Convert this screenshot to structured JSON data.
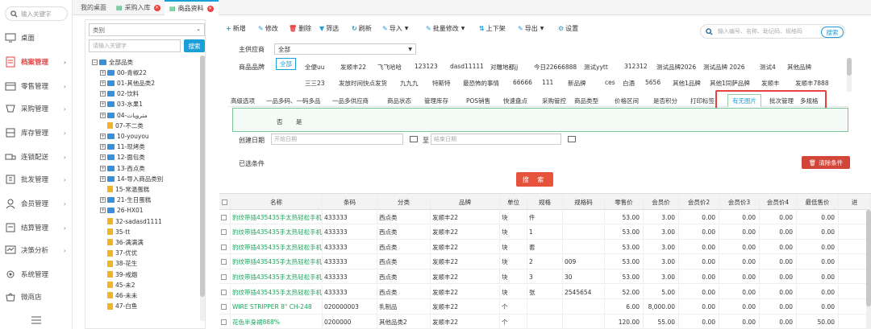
{
  "nav": {
    "search_placeholder": "输入关键字",
    "items": [
      {
        "label": "桌面",
        "icon": "desktop-icon"
      },
      {
        "label": "档案管理",
        "icon": "archive-icon",
        "active": true
      },
      {
        "label": "零售管理",
        "icon": "retail-icon"
      },
      {
        "label": "采购管理",
        "icon": "purchase-icon"
      },
      {
        "label": "库存管理",
        "icon": "inventory-icon"
      },
      {
        "label": "连锁配送",
        "icon": "delivery-icon"
      },
      {
        "label": "批发管理",
        "icon": "wholesale-icon"
      },
      {
        "label": "会员管理",
        "icon": "member-icon"
      },
      {
        "label": "结算管理",
        "icon": "settlement-icon"
      },
      {
        "label": "决策分析",
        "icon": "analysis-icon"
      },
      {
        "label": "系统管理",
        "icon": "gear-icon"
      },
      {
        "label": "微商店",
        "icon": "shop-icon"
      }
    ]
  },
  "tabs": [
    {
      "label": "我的桌面"
    },
    {
      "label": "采购入库"
    },
    {
      "label": "商品资料"
    }
  ],
  "tree": {
    "select_value": "类别",
    "search_placeholder": "请输入关键字",
    "search_button": "搜索",
    "nodes": [
      {
        "label": "全部品类",
        "level": 0,
        "type": "folder"
      },
      {
        "label": "00-青椒22",
        "level": 1,
        "type": "folder"
      },
      {
        "label": "01-其他品类2",
        "level": 1,
        "type": "folder"
      },
      {
        "label": "02-饮料",
        "level": 1,
        "type": "folder"
      },
      {
        "label": "03-水果1",
        "level": 1,
        "type": "folder"
      },
      {
        "label": "04-مترويات",
        "level": 1,
        "type": "folder"
      },
      {
        "label": "07-不二类",
        "level": 1,
        "type": "leaf"
      },
      {
        "label": "10-youyou",
        "level": 1,
        "type": "folder"
      },
      {
        "label": "11-现烤类",
        "level": 1,
        "type": "folder"
      },
      {
        "label": "12-面包类",
        "level": 1,
        "type": "folder"
      },
      {
        "label": "13-西点类",
        "level": 1,
        "type": "folder"
      },
      {
        "label": "14-导入商品类别",
        "level": 1,
        "type": "folder"
      },
      {
        "label": "15-常温蛋糕",
        "level": 1,
        "type": "leaf"
      },
      {
        "label": "21-生日蛋糕",
        "level": 1,
        "type": "folder"
      },
      {
        "label": "26-HX01",
        "level": 1,
        "type": "folder"
      },
      {
        "label": "32-sadasd1111",
        "level": 1,
        "type": "leaf"
      },
      {
        "label": "35-tt",
        "level": 1,
        "type": "leaf"
      },
      {
        "label": "36-满满满",
        "level": 1,
        "type": "leaf"
      },
      {
        "label": "37-优优",
        "level": 1,
        "type": "leaf"
      },
      {
        "label": "38-花生",
        "level": 1,
        "type": "leaf"
      },
      {
        "label": "39-戒烟",
        "level": 1,
        "type": "leaf"
      },
      {
        "label": "45-未2",
        "level": 1,
        "type": "leaf"
      },
      {
        "label": "46-未未",
        "level": 1,
        "type": "leaf"
      },
      {
        "label": "47-白鱼",
        "level": 1,
        "type": "leaf"
      }
    ]
  },
  "toolbar": {
    "new": "新增",
    "edit": "修改",
    "delete": "删除",
    "filter": "筛选",
    "refresh": "刷新",
    "import": "导入",
    "batch_edit": "批量修改",
    "onoff": "上下架",
    "export": "导出",
    "settings": "设置",
    "search_placeholder": "输入编号、名称、助记码、规格码",
    "search_button": "搜索"
  },
  "filters": {
    "supplier_label": "主供应商",
    "supplier_value": "全部",
    "brand_label": "商品品牌",
    "brands_row1": [
      "全部",
      "全便uu",
      "发顺丰22",
      "飞飞哈哈",
      "123123",
      "dasd11111",
      "对雕地都jj",
      "今日22666888",
      "测试yytt",
      "312312",
      "测试品牌2026",
      "测试品牌 2026",
      "测试4",
      "其他品牌"
    ],
    "brands_row2": [
      "三三23",
      "发放时间快点发货",
      "九九九",
      "特斯特",
      "最恐怖的事情",
      "66666",
      "111",
      "新品牌",
      "ces",
      "白酒",
      "5656",
      "其他1品牌",
      "其他1同萨品牌",
      "发顺丰",
      "发顺丰7888"
    ],
    "adv_tabs": [
      "高级选项",
      "一品多码、一码多品",
      "一品多供应商",
      "商品状态",
      "管理库存",
      "POS销售",
      "快速盘点",
      "采购管控",
      "商品类型",
      "价格区间",
      "是否积分",
      "打印标签",
      "有无图片",
      "批次管理",
      "多规格"
    ],
    "adv_active": "有无图片",
    "image_options": [
      "否",
      "是"
    ],
    "created_label": "创建日期",
    "start_placeholder": "开始日期",
    "to_label": "至",
    "end_placeholder": "结束日期",
    "conditions_label": "已选条件",
    "clear_button": "清除条件",
    "search_button": "搜 索"
  },
  "table": {
    "columns": [
      "名称",
      "条码",
      "分类",
      "品牌",
      "单位",
      "规格",
      "规格码",
      "零售价",
      "会员价",
      "会员价2",
      "会员价3",
      "会员价4",
      "最低售价",
      "进"
    ],
    "rows": [
      [
        "豹纹带插435435手太热轻松手机",
        "433333",
        "西点类",
        "发顺丰22",
        "块",
        "件",
        "",
        "53.00",
        "3.00",
        "0.00",
        "0.00",
        "0.00",
        "0.00"
      ],
      [
        "豹纹带插435435手太热轻松手机",
        "433333",
        "西点类",
        "发顺丰22",
        "块",
        "1",
        "",
        "53.00",
        "3.00",
        "0.00",
        "0.00",
        "0.00",
        "0.00"
      ],
      [
        "豹纹带插435435手太热轻松手机",
        "433333",
        "西点类",
        "发顺丰22",
        "块",
        "套",
        "",
        "53.00",
        "3.00",
        "0.00",
        "0.00",
        "0.00",
        "0.00"
      ],
      [
        "豹纹带插435435手太热轻松手机",
        "433333",
        "西点类",
        "发顺丰22",
        "块",
        "2",
        "009",
        "53.00",
        "3.00",
        "0.00",
        "0.00",
        "0.00",
        "0.00"
      ],
      [
        "豹纹带插435435手太热轻松手机",
        "433333",
        "西点类",
        "发顺丰22",
        "块",
        "3",
        "30",
        "53.00",
        "3.00",
        "0.00",
        "0.00",
        "0.00",
        "0.00"
      ],
      [
        "豹纹带插435435手太热轻松手机",
        "433333",
        "西点类",
        "发顺丰22",
        "块",
        "张",
        "2545654",
        "52.00",
        "5.00",
        "0.00",
        "0.00",
        "0.00",
        "0.00"
      ],
      [
        "WIRE STRIPPER 8\" CH-248",
        "020000003",
        "乳制品",
        "发顺丰22",
        "个",
        "",
        "",
        "6.00",
        "8,000.00",
        "0.00",
        "0.00",
        "0.00",
        "0.00"
      ],
      [
        "花色半身裙888%",
        "0200000",
        "其他品类2",
        "发顺丰22",
        "个",
        "",
        "",
        "120.00",
        "55.00",
        "0.00",
        "0.00",
        "0.00",
        "50.00"
      ]
    ]
  },
  "colors": {
    "accent": "#1a9fd8",
    "danger": "#e64340",
    "link": "#1aa55a"
  }
}
